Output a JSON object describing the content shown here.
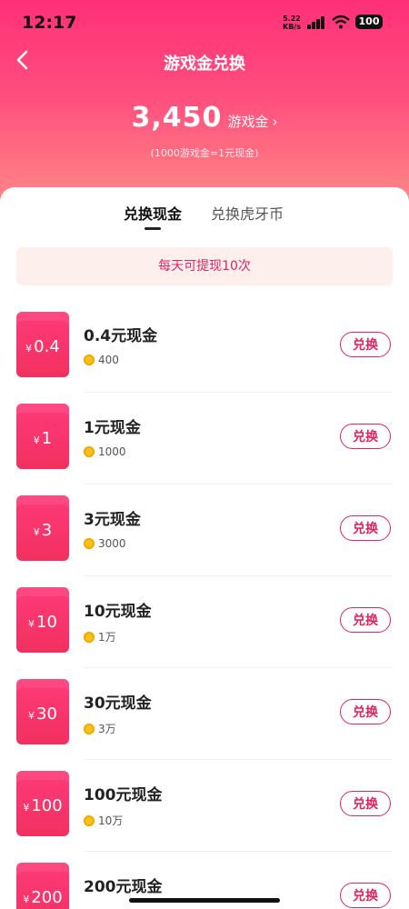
{
  "status_bar": {
    "time": "12:17",
    "net_speed": "5.22",
    "net_unit": "KB/s",
    "battery": "100"
  },
  "header": {
    "title": "游戏金兑换",
    "balance": "3,450",
    "balance_unit": "游戏金",
    "rate_note": "(1000游戏金=1元现金)"
  },
  "tabs": [
    {
      "label": "兑换现金",
      "active": true
    },
    {
      "label": "兑换虎牙币",
      "active": false
    }
  ],
  "notice": "每天可提现10次",
  "items": [
    {
      "card_value": "0.4",
      "name": "0.4元现金",
      "cost": "400",
      "button": "兑换"
    },
    {
      "card_value": "1",
      "name": "1元现金",
      "cost": "1000",
      "button": "兑换"
    },
    {
      "card_value": "3",
      "name": "3元现金",
      "cost": "3000",
      "button": "兑换"
    },
    {
      "card_value": "10",
      "name": "10元现金",
      "cost": "1万",
      "button": "兑换"
    },
    {
      "card_value": "30",
      "name": "30元现金",
      "cost": "3万",
      "button": "兑换"
    },
    {
      "card_value": "100",
      "name": "100元现金",
      "cost": "10万",
      "button": "兑换"
    },
    {
      "card_value": "200",
      "name": "200元现金",
      "cost": "",
      "button": "兑换"
    }
  ],
  "currency_symbol": "¥",
  "colors": {
    "accent": "#e0245e",
    "header_top": "#ff2f78",
    "header_bottom": "#ff8f88",
    "coin": "#ffc21a"
  }
}
